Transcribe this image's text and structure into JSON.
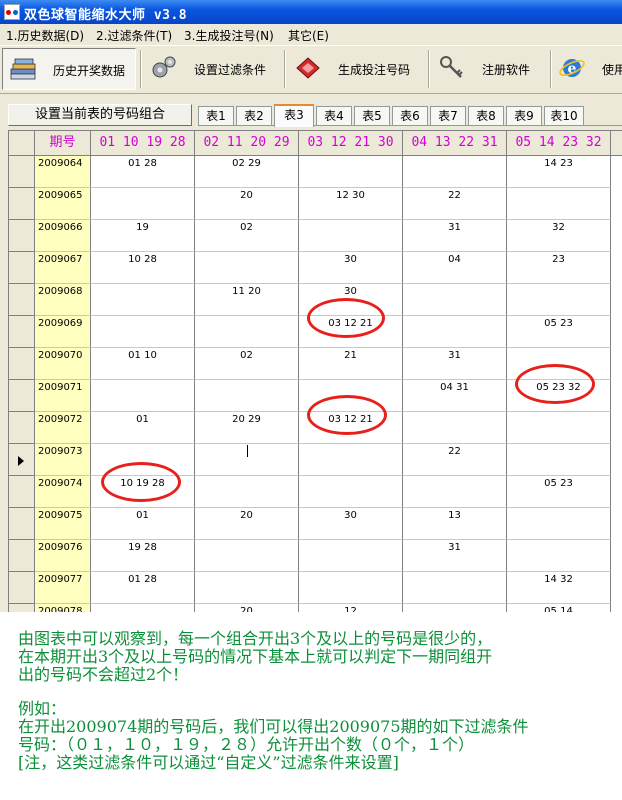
{
  "window": {
    "title": "双色球智能缩水大师 v3.8"
  },
  "menu": [
    {
      "label": "1.历史数据(D)"
    },
    {
      "label": "2.过滤条件(T)"
    },
    {
      "label": "3.生成投注号(N)"
    },
    {
      "label": "其它(E)"
    }
  ],
  "toolbar": [
    {
      "label": "历史开奖数据",
      "icon": "books-icon",
      "pressed": true
    },
    {
      "label": "设置过滤条件",
      "icon": "gears-icon",
      "pressed": false
    },
    {
      "label": "生成投注号码",
      "icon": "red-card-icon",
      "pressed": false
    },
    {
      "label": "注册软件",
      "icon": "keys-icon",
      "pressed": false
    },
    {
      "label": "使用",
      "icon": "ie-icon",
      "pressed": false
    }
  ],
  "set_button": "设置当前表的号码组合",
  "tabs": [
    "表1",
    "表2",
    "表3",
    "表4",
    "表5",
    "表6",
    "表7",
    "表8",
    "表9",
    "表10"
  ],
  "active_tab": 2,
  "grid": {
    "period_header": "期号",
    "columns": [
      "01 10 19 28",
      "02 11 20 29",
      "03 12 21 30",
      "04 13 22 31",
      "05 14 23 32"
    ],
    "rows": [
      {
        "period": "2009064",
        "cells": [
          "01 28",
          "02 29",
          "",
          "",
          "14 23"
        ]
      },
      {
        "period": "2009065",
        "cells": [
          "",
          "20",
          "12 30",
          "22",
          ""
        ]
      },
      {
        "period": "2009066",
        "cells": [
          "19",
          "02",
          "",
          "31",
          "32"
        ]
      },
      {
        "period": "2009067",
        "cells": [
          "10 28",
          "",
          "30",
          "04",
          "23"
        ]
      },
      {
        "period": "2009068",
        "cells": [
          "",
          "11 20",
          "30",
          "",
          ""
        ]
      },
      {
        "period": "2009069",
        "cells": [
          "",
          "",
          "03 12 21",
          "",
          "05 23"
        ]
      },
      {
        "period": "2009070",
        "cells": [
          "01 10",
          "02",
          "21",
          "31",
          ""
        ]
      },
      {
        "period": "2009071",
        "cells": [
          "",
          "",
          "",
          "04 31",
          "05 23 32"
        ]
      },
      {
        "period": "2009072",
        "cells": [
          "01",
          "20 29",
          "03 12 21",
          "",
          ""
        ]
      },
      {
        "period": "2009073",
        "cells": [
          "",
          "",
          "",
          "22",
          ""
        ]
      },
      {
        "period": "2009074",
        "cells": [
          "10 19 28",
          "",
          "",
          "",
          "05 23"
        ]
      },
      {
        "period": "2009075",
        "cells": [
          "01",
          "20",
          "30",
          "13",
          ""
        ]
      },
      {
        "period": "2009076",
        "cells": [
          "19 28",
          "",
          "",
          "31",
          ""
        ]
      },
      {
        "period": "2009077",
        "cells": [
          "01 28",
          "",
          "",
          "",
          "14 32"
        ]
      },
      {
        "period": "2009078",
        "cells": [
          "",
          "20",
          "12",
          "",
          "05 14"
        ]
      }
    ],
    "current_row": 9
  },
  "colors": {
    "header_text": "#d400d4",
    "period_bg": "#ffffc0",
    "circle": "#e8201c",
    "note_text": "#0d8f3a"
  },
  "note": {
    "line1": "由图表中可以观察到，每一个组合开出3个及以上的号码是很少的，",
    "line2": "在本期开出3个及以上号码的情况下基本上就可以判定下一期同组开",
    "line3": "出的号码不会超过2个！",
    "line4": "例如：",
    "line5": "在开出2009074期的号码后，我们可以得出2009075期的如下过滤条件",
    "line6": "号码：（０１，１０，１９，２８）允许开出个数（０个，１个）",
    "line7": "[注，这类过滤条件可以通过“自定义”过滤条件来设置]"
  }
}
